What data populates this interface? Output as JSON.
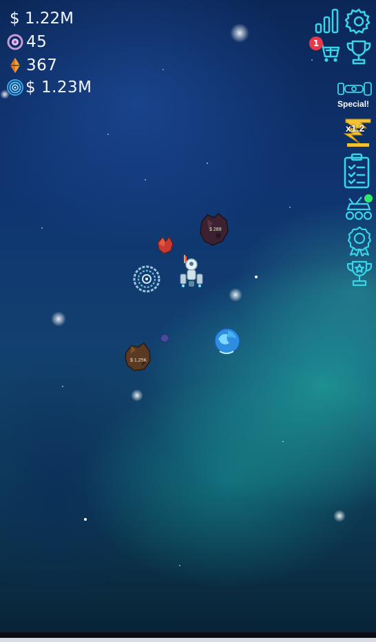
{
  "hud": {
    "money": "$ 1.22M",
    "gems": "45",
    "crystals": "367",
    "income": "$ 1.23M"
  },
  "side_menu": {
    "shop_badge": "1",
    "special_label": "Special!",
    "multiplier_label": "x1.2"
  },
  "asteroids": {
    "top_value": "$ 289",
    "left_value": "$ 1.25K"
  },
  "colors": {
    "icon_cyan": "#38d6e8",
    "gold": "#f2c230",
    "badge_red": "#e8384a",
    "online_green": "#2ee86a"
  }
}
